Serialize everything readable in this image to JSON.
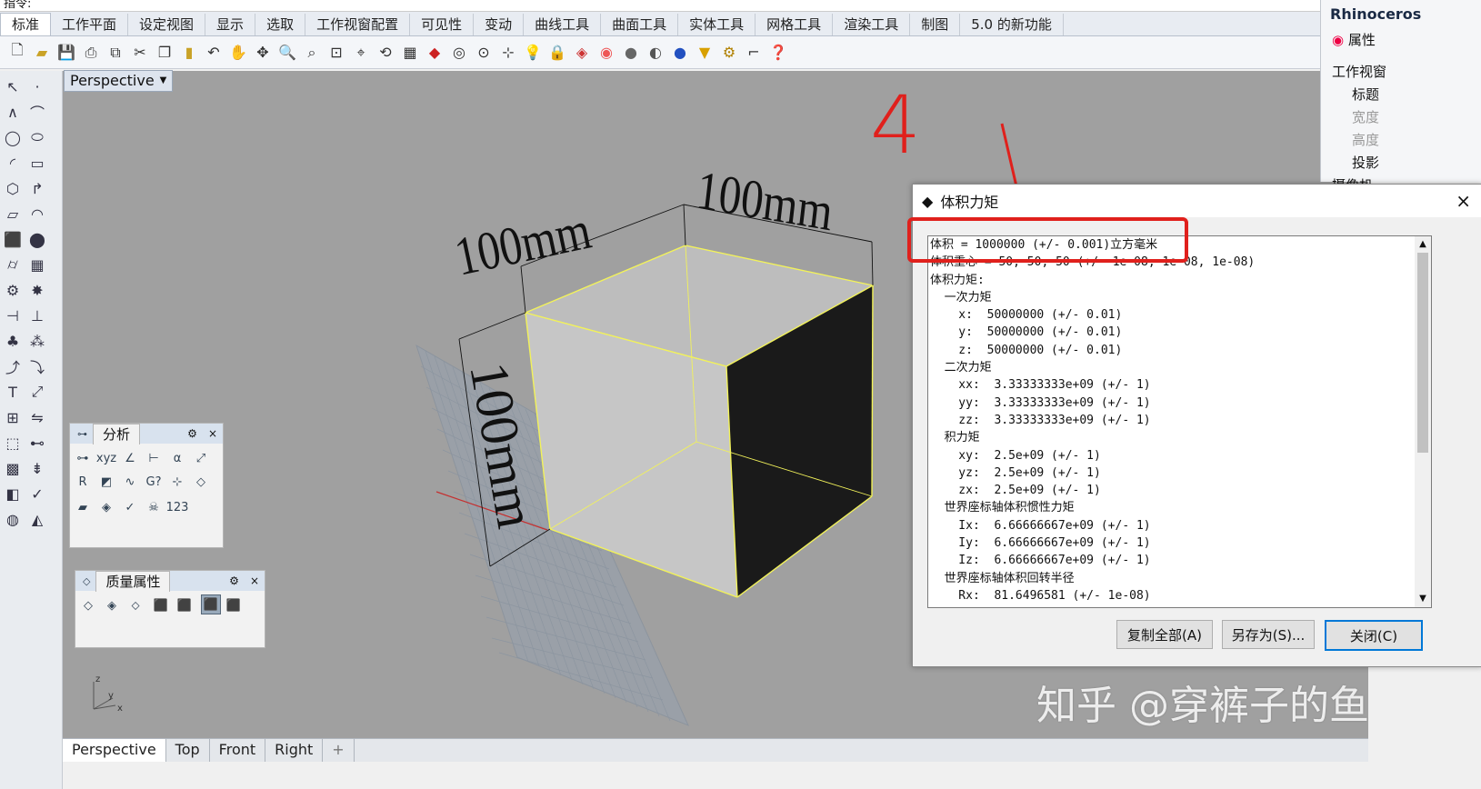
{
  "command_line": {
    "text": "指令:"
  },
  "tabs": [
    "标准",
    "工作平面",
    "设定视图",
    "显示",
    "选取",
    "工作视窗配置",
    "可见性",
    "变动",
    "曲线工具",
    "曲面工具",
    "实体工具",
    "网格工具",
    "渲染工具",
    "制图",
    "5.0 的新功能"
  ],
  "viewport": {
    "label": "Perspective",
    "dropdown_icon": "caret-down-icon",
    "axis_labels": {
      "z": "z",
      "y": "y",
      "x": "x"
    }
  },
  "dimensions": {
    "top_left": "100mm",
    "top_right": "100mm",
    "left": "100mm"
  },
  "annotation": {
    "handwritten_number": "4"
  },
  "viewport_tabs": [
    "Perspective",
    "Top",
    "Front",
    "Right",
    "+"
  ],
  "right_panel": {
    "app_title": "Rhinoceros",
    "properties_tab": "属性",
    "section_viewport": "工作视窗",
    "viewport_rows": [
      "标题",
      "宽度",
      "高度",
      "投影"
    ],
    "section_camera": "摄像机"
  },
  "analysis_panel": {
    "title": "分析"
  },
  "mass_panel": {
    "title": "质量属性"
  },
  "dialog": {
    "title": "体积力矩",
    "close_glyph": "×",
    "lines": [
      "体积 = 1000000 (+/- 0.001)立方毫米",
      "体积重心 = 50, 50, 50 (+/- 1e-08, 1e-08, 1e-08)",
      "体积力矩:",
      "  一次力矩",
      "    x:  50000000 (+/- 0.01)",
      "    y:  50000000 (+/- 0.01)",
      "    z:  50000000 (+/- 0.01)",
      "  二次力矩",
      "    xx:  3.33333333e+09 (+/- 1)",
      "    yy:  3.33333333e+09 (+/- 1)",
      "    zz:  3.33333333e+09 (+/- 1)",
      "  积力矩",
      "    xy:  2.5e+09 (+/- 1)",
      "    yz:  2.5e+09 (+/- 1)",
      "    zx:  2.5e+09 (+/- 1)",
      "  世界座标轴体积惯性力矩",
      "    Ix:  6.66666667e+09 (+/- 1)",
      "    Iy:  6.66666667e+09 (+/- 1)",
      "    Iz:  6.66666667e+09 (+/- 1)",
      "  世界座标轴体积回转半径",
      "    Rx:  81.6496581 (+/- 1e-08)"
    ],
    "buttons": {
      "copy_all": "复制全部(A)",
      "save_as": "另存为(S)...",
      "close": "关闭(C)"
    }
  },
  "watermark": "知乎 @穿裤子的鱼",
  "colors": {
    "highlight": "#e0201c",
    "edge": "#f2f25a",
    "viewport_bg": "#a0a0a0"
  }
}
